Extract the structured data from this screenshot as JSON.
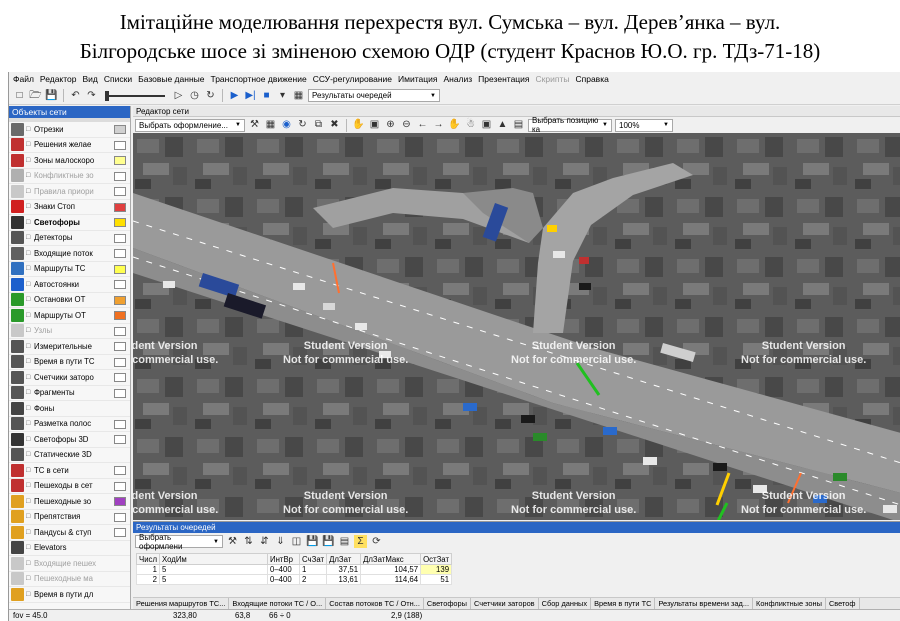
{
  "caption": {
    "line1": "Імітаційне моделювання перехрестя вул. Сумська – вул. Дерев’янка – вул.",
    "line2": "Білгородське шосе зі зміненою схемою ОДР (студент Краснов Ю.О. гр. ТДз-71-18)"
  },
  "menu": [
    {
      "label": "Файл",
      "enabled": true
    },
    {
      "label": "Редактор",
      "enabled": true
    },
    {
      "label": "Вид",
      "enabled": true
    },
    {
      "label": "Списки",
      "enabled": true
    },
    {
      "label": "Базовые данные",
      "enabled": true
    },
    {
      "label": "Транспортное движение",
      "enabled": true
    },
    {
      "label": "ССУ-регулирование",
      "enabled": true
    },
    {
      "label": "Имитация",
      "enabled": true
    },
    {
      "label": "Анализ",
      "enabled": true
    },
    {
      "label": "Презентация",
      "enabled": true
    },
    {
      "label": "Скрипты",
      "enabled": false
    },
    {
      "label": "Справка",
      "enabled": true
    }
  ],
  "toolbar": {
    "results_combo": "Результаты очередей",
    "speed_level": 0.0
  },
  "left_panel": {
    "title": "Объекты сети",
    "items": [
      {
        "label": "Отрезки",
        "icon": "road-segment-icon",
        "color": "#6a6a6a",
        "swatch": "#d0d0d0",
        "dim": false,
        "bold": false
      },
      {
        "label": "Решения желае",
        "icon": "route-decision-icon",
        "color": "#c03030",
        "swatch": "#ffffff",
        "dim": false,
        "bold": false
      },
      {
        "label": "Зоны малоскоро",
        "icon": "slow-zone-icon",
        "color": "#c03030",
        "swatch": "#ffff90",
        "dim": false,
        "bold": false
      },
      {
        "label": "Конфликтные зо",
        "icon": "conflict-zone-icon",
        "color": "#b0b0b0",
        "swatch": "#ffffff",
        "dim": true,
        "bold": false
      },
      {
        "label": "Правила приори",
        "icon": "priority-rule-icon",
        "color": "#c8c8c8",
        "swatch": "#ffffff",
        "dim": true,
        "bold": false
      },
      {
        "label": "Знаки Стоп",
        "icon": "stop-sign-icon",
        "color": "#d02020",
        "swatch": "#e04040",
        "dim": false,
        "bold": false
      },
      {
        "label": "Светофоры",
        "icon": "traffic-light-icon",
        "color": "#333333",
        "swatch": "#ffe000",
        "dim": false,
        "bold": true
      },
      {
        "label": "Детекторы",
        "icon": "detector-icon",
        "color": "#555555",
        "swatch": "#ffffff",
        "dim": false,
        "bold": false
      },
      {
        "label": "Входящие поток",
        "icon": "vehicle-input-icon",
        "color": "#606060",
        "swatch": "#ffffff",
        "dim": false,
        "bold": false
      },
      {
        "label": "Маршруты ТС",
        "icon": "vehicle-route-icon",
        "color": "#3070c0",
        "swatch": "#ffff50",
        "dim": false,
        "bold": false
      },
      {
        "label": "Автостоянки",
        "icon": "parking-icon",
        "color": "#1c5fcc",
        "swatch": "#ffffff",
        "dim": false,
        "bold": false
      },
      {
        "label": "Остановки ОТ",
        "icon": "transit-stop-icon",
        "color": "#2a9a2a",
        "swatch": "#f0a030",
        "dim": false,
        "bold": false
      },
      {
        "label": "Маршруты ОТ",
        "icon": "transit-route-icon",
        "color": "#2a9a2a",
        "swatch": "#f07020",
        "dim": false,
        "bold": false
      },
      {
        "label": "Узлы",
        "icon": "node-icon",
        "color": "#c8c8c8",
        "swatch": "#ffffff",
        "dim": true,
        "bold": false
      },
      {
        "label": "Измерительные",
        "icon": "measurement-icon",
        "color": "#555555",
        "swatch": "#ffffff",
        "dim": false,
        "bold": false
      },
      {
        "label": "Время в пути ТС",
        "icon": "travel-time-icon",
        "color": "#555555",
        "swatch": "#ffffff",
        "dim": false,
        "bold": false
      },
      {
        "label": "Счетчики заторо",
        "icon": "queue-counter-icon",
        "color": "#555555",
        "swatch": "#ffffff",
        "dim": false,
        "bold": false
      },
      {
        "label": "Фрагменты",
        "icon": "section-icon",
        "color": "#555555",
        "swatch": "#ffffff",
        "dim": false,
        "bold": false
      },
      {
        "label": "Фоны",
        "icon": "background-icon",
        "color": "#444444",
        "swatch": "",
        "dim": false,
        "bold": false
      },
      {
        "label": "Разметка полос",
        "icon": "lane-marking-icon",
        "color": "#555555",
        "swatch": "#ffffff",
        "dim": false,
        "bold": false
      },
      {
        "label": "Светофоры 3D",
        "icon": "traffic-light-3d-icon",
        "color": "#333333",
        "swatch": "#ffffff",
        "dim": false,
        "bold": false
      },
      {
        "label": "Статические 3D",
        "icon": "static-3d-icon",
        "color": "#555555",
        "swatch": "",
        "dim": false,
        "bold": false
      },
      {
        "label": "ТС в сети",
        "icon": "vehicles-in-network-icon",
        "color": "#c03030",
        "swatch": "#ffffff",
        "dim": false,
        "bold": false
      },
      {
        "label": "Пешеходы в сет",
        "icon": "pedestrians-in-network-icon",
        "color": "#c03030",
        "swatch": "#ffffff",
        "dim": false,
        "bold": false
      },
      {
        "label": "Пешеходные зо",
        "icon": "pedestrian-area-icon",
        "color": "#e0a020",
        "swatch": "#a040c0",
        "dim": false,
        "bold": false
      },
      {
        "label": "Препятствия",
        "icon": "obstacle-icon",
        "color": "#e0a020",
        "swatch": "#ffffff",
        "dim": false,
        "bold": false
      },
      {
        "label": "Пандусы & ступ",
        "icon": "ramp-icon",
        "color": "#e0a020",
        "swatch": "#ffffff",
        "dim": false,
        "bold": false
      },
      {
        "label": "Elevators",
        "icon": "elevator-icon",
        "color": "#444444",
        "swatch": "",
        "dim": false,
        "bold": false
      },
      {
        "label": "Входящие пешех",
        "icon": "pedestrian-input-icon",
        "color": "#c8c8c8",
        "swatch": "",
        "dim": true,
        "bold": false
      },
      {
        "label": "Пешеходные ма",
        "icon": "pedestrian-route-icon",
        "color": "#c8c8c8",
        "swatch": "",
        "dim": true,
        "bold": false
      },
      {
        "label": "Время в пути дл",
        "icon": "pedestrian-travel-time-icon",
        "color": "#e0a020",
        "swatch": "",
        "dim": false,
        "bold": false
      }
    ]
  },
  "editor": {
    "title": "Редактор сети",
    "style_combo": "Выбрать оформление...",
    "position_combo": "Выбрать позицию ка",
    "zoom": "100%",
    "watermark_line1": "Student Version",
    "watermark_line2": "Not for commercial use."
  },
  "results": {
    "title": "Результаты очередей",
    "style_combo": "Выбрать оформлени",
    "columns": [
      "Числ",
      "ХодИм",
      "ИнтВр",
      "СчЗат",
      "ДлЗат",
      "ДлЗатМакс",
      "ОстЗат"
    ],
    "rows": [
      {
        "num": "1",
        "run": "5",
        "interval": "0–400",
        "counter": "1",
        "qlen": "37,51",
        "qlen_max": "104,57",
        "stops": "139"
      },
      {
        "num": "2",
        "run": "5",
        "interval": "0–400",
        "counter": "2",
        "qlen": "13,61",
        "qlen_max": "114,64",
        "stops": "51"
      }
    ],
    "tabs": [
      "Решения маршрутов ТС...",
      "Входящие потоки ТС / О...",
      "Состав потоков ТС / Отн...",
      "Светофоры",
      "Счетчики заторов",
      "Сбор данных",
      "Время в пути ТС",
      "Результаты времени зад...",
      "Конфликтные зоны",
      "Светоф"
    ]
  },
  "status": {
    "fov": "fov = 45.0",
    "x": "323,80",
    "y": "63,8",
    "z": "66 ÷ 0",
    "time": "2,9 (188)"
  }
}
